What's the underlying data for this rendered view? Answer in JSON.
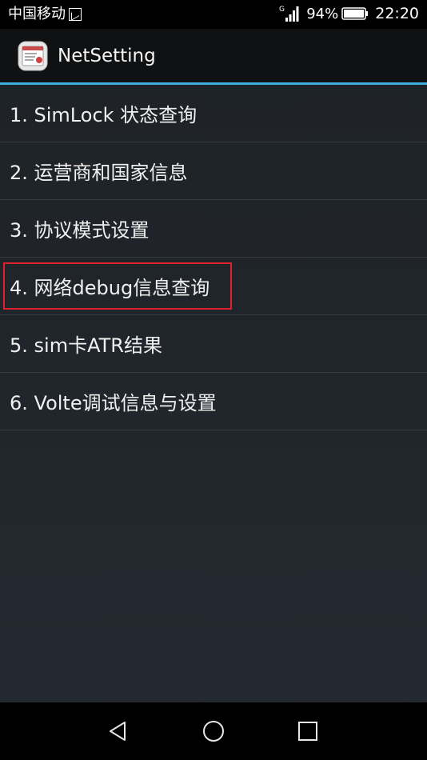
{
  "status_bar": {
    "carrier": "中国移动",
    "network_type": "G",
    "battery_percent": "94%",
    "time": "22:20",
    "icons": [
      "sim-icon",
      "signal-icon",
      "battery-icon"
    ]
  },
  "action_bar": {
    "title": "NetSetting",
    "icon": "netsetting-app-icon",
    "accent_color": "#3fb0e0"
  },
  "menu": {
    "items": [
      {
        "label": "1. SimLock 状态查询"
      },
      {
        "label": "2. 运营商和国家信息"
      },
      {
        "label": "3. 协议模式设置"
      },
      {
        "label": "4. 网络debug信息查询",
        "highlighted": true
      },
      {
        "label": "5. sim卡ATR结果"
      },
      {
        "label": "6. Volte调试信息与设置"
      }
    ],
    "highlight_color": "#e0202a"
  },
  "nav_bar": {
    "buttons": [
      "back-icon",
      "home-icon",
      "recent-apps-icon"
    ]
  }
}
